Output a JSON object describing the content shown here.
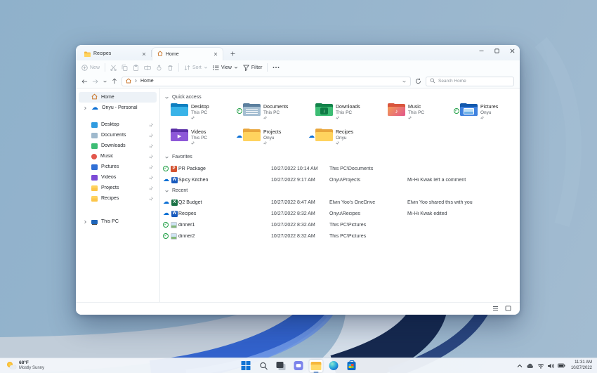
{
  "window": {
    "tabs": [
      {
        "label": "Recipes",
        "icon": "folder-icon"
      },
      {
        "label": "Home",
        "icon": "home-icon"
      }
    ],
    "toolbar": {
      "new_label": "New",
      "sort_label": "Sort",
      "view_label": "View",
      "filter_label": "Filter"
    },
    "breadcrumb": {
      "root": "Home"
    },
    "search_placeholder": "Search Home",
    "sidebar": [
      {
        "label": "Home",
        "icon": "home-icon"
      },
      {
        "label": "Onyu - Personal",
        "icon": "onedrive-cloud-icon"
      },
      {
        "label": "Desktop",
        "icon": "desktop-folder-icon"
      },
      {
        "label": "Documents",
        "icon": "documents-folder-icon"
      },
      {
        "label": "Downloads",
        "icon": "downloads-folder-icon"
      },
      {
        "label": "Music",
        "icon": "music-icon"
      },
      {
        "label": "Pictures",
        "icon": "pictures-folder-icon"
      },
      {
        "label": "Videos",
        "icon": "videos-folder-icon"
      },
      {
        "label": "Projects",
        "icon": "folder-icon"
      },
      {
        "label": "Recipes",
        "icon": "folder-icon"
      },
      {
        "label": "This PC",
        "icon": "this-pc-icon"
      }
    ],
    "sections": {
      "quick_access": {
        "title": "Quick access",
        "items": [
          {
            "name": "Desktop",
            "location": "This PC",
            "icon": "folder-desktop-icon",
            "status": "none"
          },
          {
            "name": "Documents",
            "location": "This PC",
            "icon": "folder-documents-icon",
            "status": "synced"
          },
          {
            "name": "Downloads",
            "location": "This PC",
            "icon": "folder-downloads-icon",
            "status": "none"
          },
          {
            "name": "Music",
            "location": "This PC",
            "icon": "folder-music-icon",
            "status": "none"
          },
          {
            "name": "Pictures",
            "location": "Onyu",
            "icon": "folder-pictures-icon",
            "status": "synced"
          },
          {
            "name": "Videos",
            "location": "This PC",
            "icon": "folder-videos-icon",
            "status": "none"
          },
          {
            "name": "Projects",
            "location": "Onyu",
            "icon": "folder-generic-icon",
            "status": "cloud"
          },
          {
            "name": "Recipes",
            "location": "Onyu",
            "icon": "folder-generic-icon",
            "status": "cloud"
          }
        ]
      },
      "favorites": {
        "title": "Favorites",
        "rows": [
          {
            "name": "PR Package",
            "date": "10/27/2022 10:14 AM",
            "location": "This PC\\Documents",
            "activity": "",
            "file_icon": "powerpoint-file-icon",
            "status": "synced"
          },
          {
            "name": "Spicy Kitchen",
            "date": "10/27/2022 9:17 AM",
            "location": "Onyu\\Projects",
            "activity": "Mi-Hi Kwak left a comment",
            "file_icon": "word-file-icon",
            "status": "cloud"
          }
        ]
      },
      "recent": {
        "title": "Recent",
        "rows": [
          {
            "name": "Q2 Budget",
            "date": "10/27/2022 8:47 AM",
            "location": "Elvin Yoo's OneDrive",
            "activity": "Elvin Yoo shared this with you",
            "file_icon": "excel-file-icon",
            "status": "cloud"
          },
          {
            "name": "Recipes",
            "date": "10/27/2022 8:32 AM",
            "location": "Onyu\\Recipes",
            "activity": "Mi-Hi Kwak edited",
            "file_icon": "word-file-icon",
            "status": "cloud"
          },
          {
            "name": "dinner1",
            "date": "10/27/2022 8:32 AM",
            "location": "This PC\\Pictures",
            "activity": "",
            "file_icon": "image-file-icon",
            "status": "synced"
          },
          {
            "name": "dinner2",
            "date": "10/27/2022 8:32 AM",
            "location": "This PC\\Pictures",
            "activity": "",
            "file_icon": "image-file-icon",
            "status": "synced"
          }
        ]
      }
    }
  },
  "taskbar": {
    "weather": {
      "temp": "68°F",
      "condition": "Mostly Sunny",
      "icon": "sun-cloud-icon"
    },
    "apps": [
      "start",
      "search",
      "task-view",
      "chat",
      "file-explorer",
      "edge",
      "store"
    ],
    "clock": {
      "time": "11:31 AM",
      "date": "10/27/2022"
    }
  },
  "colors": {
    "accent_blue": "#0b6fd4",
    "folder_yellow": "#ffd35e",
    "synced_green": "#1e9e44",
    "wallpaper_blue": "#97b5cd",
    "bloom_navy": "#16294f",
    "bloom_royal": "#2c5ecb",
    "window_bg": "#ffffff",
    "taskbar_bg": "#f3f7fb"
  }
}
